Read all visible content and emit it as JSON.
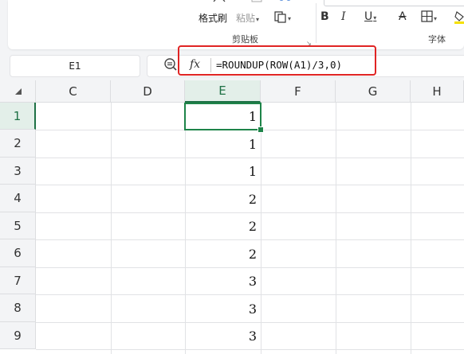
{
  "ribbon": {
    "format_painter_label": "格式刷",
    "paste_label": "粘贴",
    "clipboard_group_label": "剪贴板",
    "font_group_label": "字体",
    "bold_label": "B",
    "italic_label": "I",
    "underline_label": "U",
    "strikethrough_label": "A"
  },
  "formula_bar": {
    "name_box": "E1",
    "fx_label": "fx",
    "formula": "=ROUNDUP(ROW(A1)/3,0)"
  },
  "grid": {
    "columns": [
      "C",
      "D",
      "E",
      "F",
      "G",
      "H"
    ],
    "active_column": "E",
    "rows": [
      "1",
      "2",
      "3",
      "4",
      "5",
      "6",
      "7",
      "8",
      "9"
    ],
    "active_row": "1",
    "column_e_values": [
      "1",
      "1",
      "1",
      "2",
      "2",
      "2",
      "3",
      "3",
      "3"
    ]
  },
  "colors": {
    "selection": "#1e8449",
    "highlight_box": "#e02424"
  }
}
